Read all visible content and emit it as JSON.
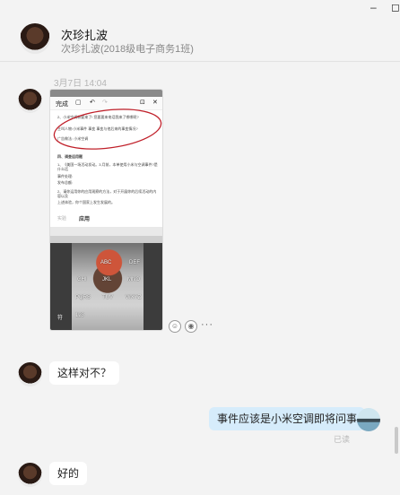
{
  "window": {
    "minimize_glyph": "–",
    "restore_glyph": "◻"
  },
  "header": {
    "name": "次珍扎波",
    "subtitle": "次珍扎波(2018级电子商务1班)"
  },
  "messages": {
    "timestamp": "3月7日 14:04",
    "question": "这样对不？",
    "outgoing": "事件应该是小米空调即将问事",
    "read_status": "已读",
    "reply": "好的"
  },
  "screenshot": {
    "toolbar": {
      "done": "完成",
      "icons": [
        "calendar-icon",
        "undo-icon",
        "redo-icon",
        "image-icon",
        "close-icon"
      ]
    },
    "doc_lines": [
      "2、小米空调新要来了!  您要要来电话我来了哪哪呢?",
      "主叫人物:小米事件   事变   事变与他后来的事变情况?",
      "广告做法:   小米空调",
      "四、调查运用题",
      "1、《美国一场活动发动。3.月前，本单使用小米与空调事件?是什么话",
      "事件处理:",
      "发布总额:",
      "2、请你运用你的应用观察的方法，对于开展你的后续活动的内容以及",
      "上述体验，你个国家上发生发展的。"
    ],
    "footer_label": "实验",
    "footer_word": "应用",
    "keys": [
      "ABC",
      "DEF",
      "GHI",
      "JKL",
      "MNO",
      "PQRS",
      "TUV",
      "WXYZ",
      "符",
      "123"
    ]
  },
  "actions": {
    "icons": [
      "emoji-icon",
      "reaction-icon",
      "more-icon"
    ]
  },
  "colors": {
    "outgoing_bubble": "#d6ecfb",
    "annotation_circle": "#c0202a"
  }
}
